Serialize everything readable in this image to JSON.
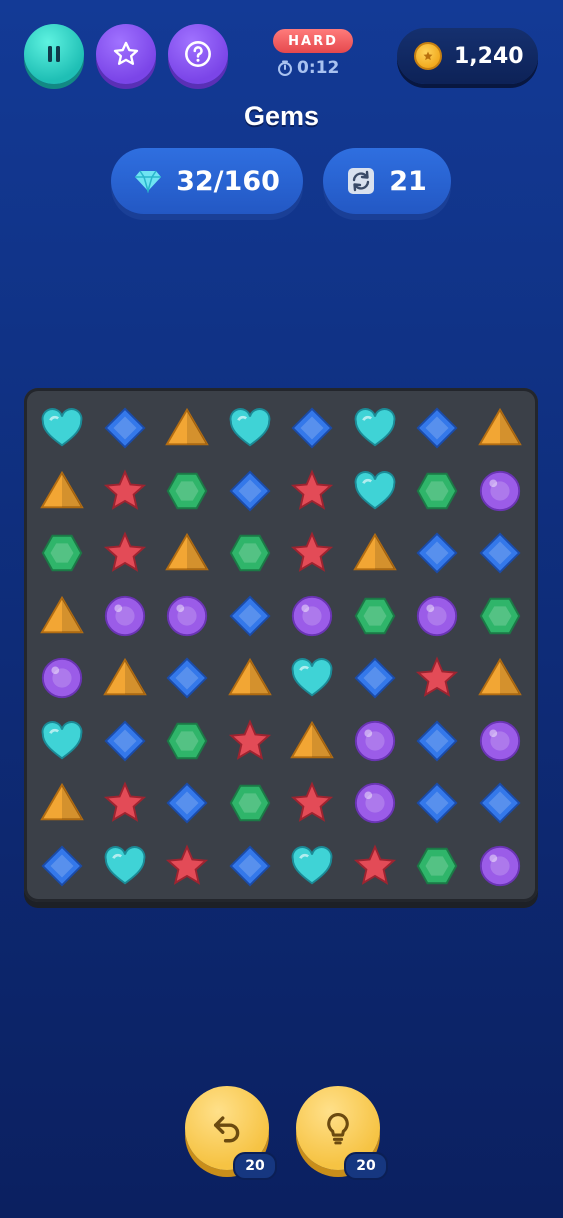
{
  "header": {
    "difficulty": "HARD",
    "timer": "0:12",
    "coins": "1,240"
  },
  "title": "Gems",
  "stats": {
    "gems": "32/160",
    "moves": "21"
  },
  "board": {
    "rows": 8,
    "cols": 8,
    "grid": [
      [
        "heart",
        "diamond",
        "triangle",
        "heart",
        "diamond",
        "heart",
        "diamond",
        "triangle"
      ],
      [
        "triangle",
        "star",
        "hexagon",
        "diamond",
        "star",
        "heart",
        "hexagon",
        "circle"
      ],
      [
        "hexagon",
        "star",
        "triangle",
        "hexagon",
        "star",
        "triangle",
        "diamond",
        "diamond"
      ],
      [
        "triangle",
        "circle",
        "circle",
        "diamond",
        "circle",
        "hexagon",
        "circle",
        "hexagon"
      ],
      [
        "circle",
        "triangle",
        "diamond",
        "triangle",
        "heart",
        "diamond",
        "star",
        "triangle"
      ],
      [
        "heart",
        "diamond",
        "hexagon",
        "star",
        "triangle",
        "circle",
        "diamond",
        "circle"
      ],
      [
        "triangle",
        "star",
        "diamond",
        "hexagon",
        "star",
        "circle",
        "diamond",
        "diamond"
      ],
      [
        "diamond",
        "heart",
        "star",
        "diamond",
        "heart",
        "star",
        "hexagon",
        "circle"
      ]
    ],
    "gem_colors": {
      "heart": "#3fd3d6",
      "diamond": "#3478ea",
      "triangle": "#f2a634",
      "star": "#e34b57",
      "hexagon": "#2fb56a",
      "circle": "#9b5ce8"
    }
  },
  "boosters": {
    "undo_count": "20",
    "hint_count": "20"
  },
  "icons": [
    "pause-icon",
    "star-icon",
    "help-icon",
    "clock-icon",
    "coin-icon",
    "gem-icon",
    "shuffle-icon",
    "undo-icon",
    "bulb-icon"
  ]
}
